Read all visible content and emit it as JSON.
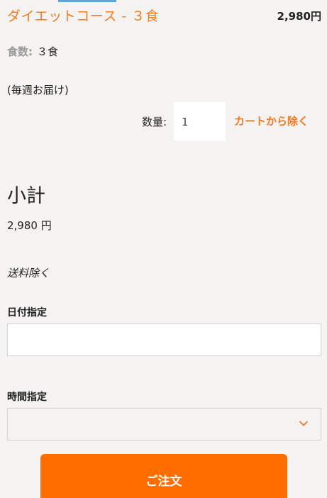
{
  "cart_item": {
    "title": "ダイエットコース - ３食",
    "price": "2,980円",
    "meals_label": "食数:",
    "meals_value": "３食",
    "delivery_note": "(毎週お届け)",
    "quantity_label": "数量:",
    "quantity_value": "1",
    "remove_label": "カートから除く"
  },
  "summary": {
    "subtotal_title": "小計",
    "subtotal_value": "2,980 円",
    "shipping_note": "送料除く"
  },
  "delivery": {
    "date_label": "日付指定",
    "date_value": "",
    "time_label": "時間指定",
    "time_value": ""
  },
  "order_button_label": "ご注文",
  "colors": {
    "accent": "#f47a22",
    "order_button": "#ff6d00",
    "background": "#f5f3f1"
  },
  "icons": {
    "time_select_arrow": "chevron-down-icon"
  }
}
